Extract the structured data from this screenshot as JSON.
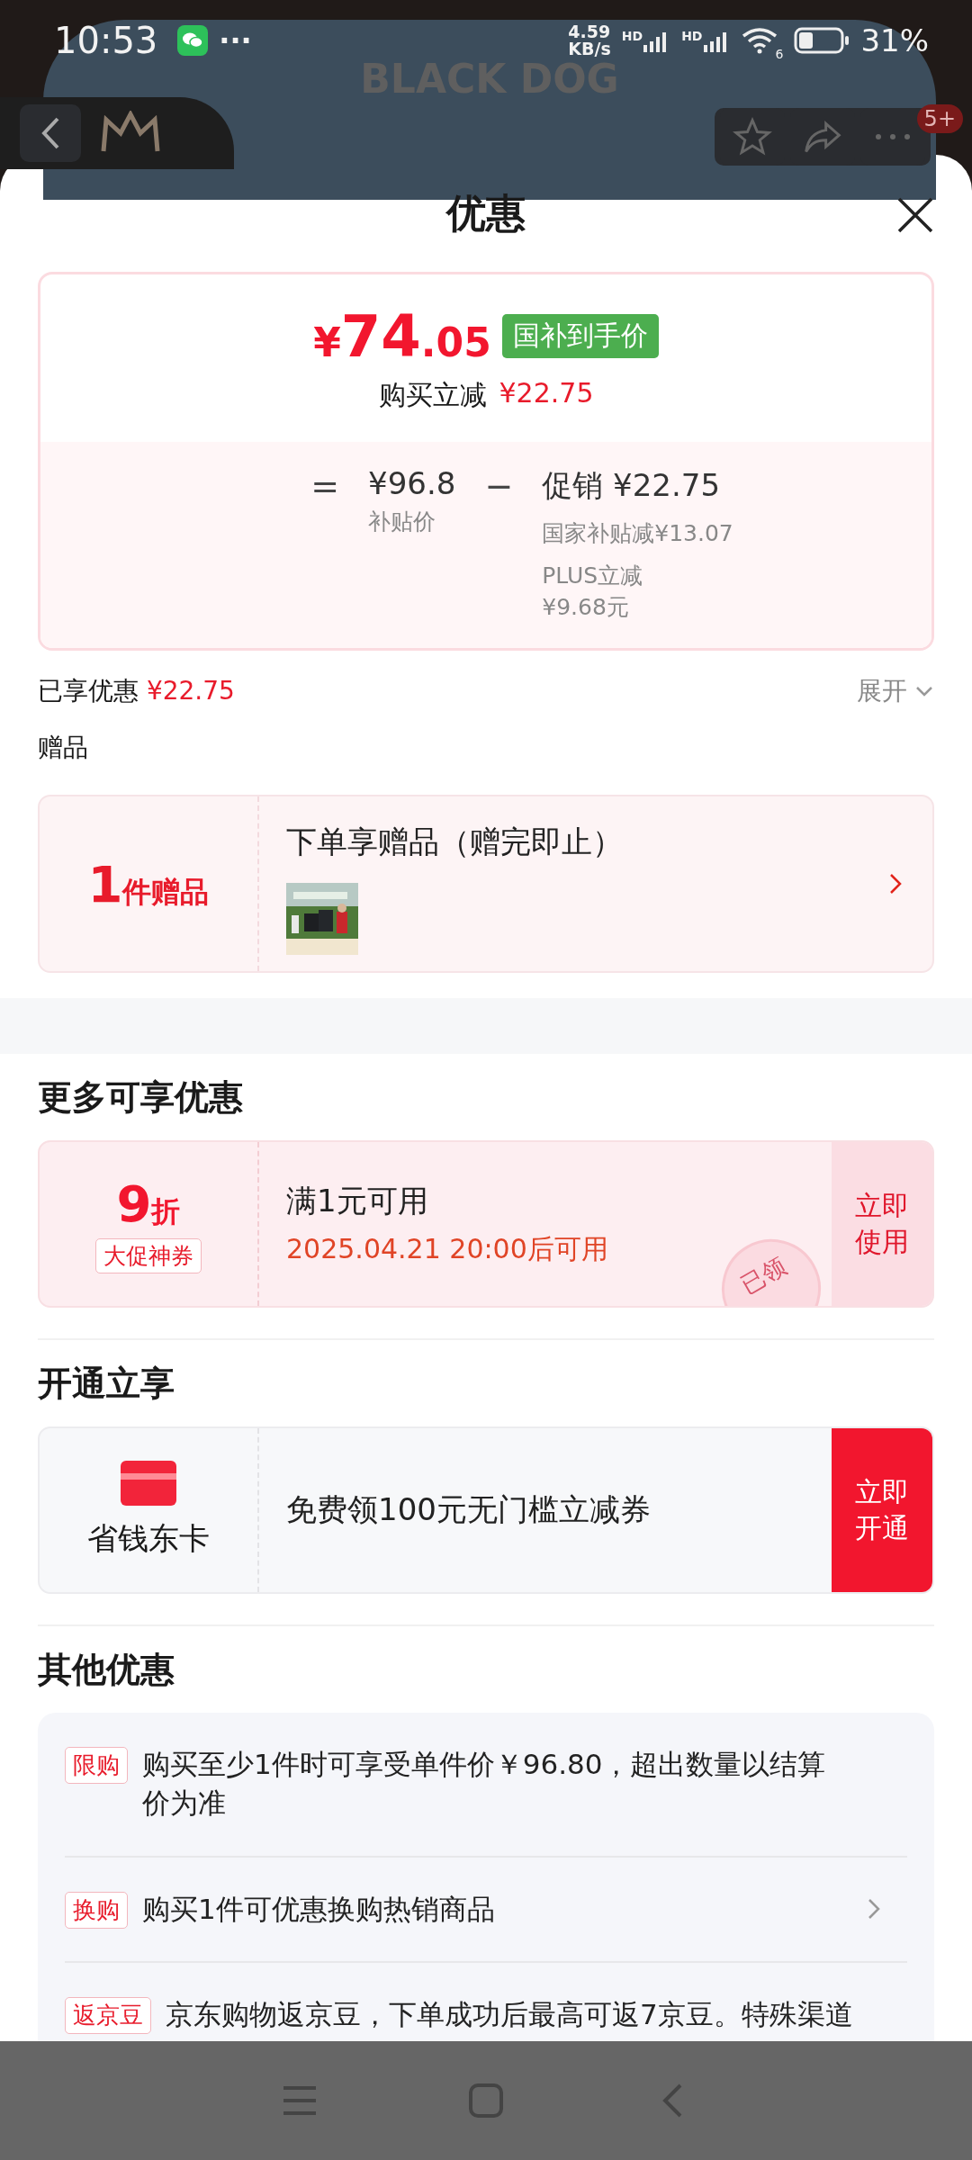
{
  "status_bar": {
    "time": "10:53",
    "more": "···",
    "speed_value": "4.59",
    "speed_unit": "KB/s",
    "signal_labels": [
      "HD",
      "HD"
    ],
    "wifi_label": "6",
    "battery": "31%"
  },
  "backdrop": {
    "logo": "BLACK DOG",
    "badge": "5+"
  },
  "sheet": {
    "title": "优惠"
  },
  "price_card": {
    "currency": "¥",
    "integer": "74",
    "decimal": ".05",
    "badge": "国补到手价",
    "saving_label": "购买立减",
    "saving_value": "¥22.75",
    "equals": "=",
    "base_price": "¥96.8",
    "base_label": "补贴价",
    "minus": "−",
    "promo_label": "促销",
    "promo_value": "¥22.75",
    "details": [
      [
        "国家补贴减¥13.07"
      ],
      [
        "PLUS立减",
        "¥9.68元"
      ]
    ]
  },
  "summary": {
    "label": "已享优惠",
    "value": "¥22.75",
    "toggle": "展开",
    "expanded": false
  },
  "gifts": {
    "heading": "赠品",
    "count": "1",
    "count_label": "件赠品",
    "title": "下单享赠品（赠完即止）"
  },
  "more_offers": {
    "heading": "更多可享优惠",
    "coupons": [
      {
        "discount": "9",
        "unit": "折",
        "tag": "大促神券",
        "condition": "满1元可用",
        "validity": "2025.04.21 20:00后可用",
        "action": "立即使用",
        "claimed": true,
        "stamp": "已领"
      }
    ]
  },
  "membership": {
    "heading": "开通立享",
    "card_name": "省钱东卡",
    "offer": "免费领100元无门槛立减券",
    "action": "立即开通"
  },
  "other_offers": {
    "heading": "其他优惠",
    "items": [
      {
        "tag": "限购",
        "text": "购买至少1件时可享受单件价￥96.80，超出数量以结算价为准",
        "has_arrow": false
      },
      {
        "tag": "换购",
        "text": "购买1件可优惠换购热销商品",
        "has_arrow": true
      },
      {
        "tag": "返京豆",
        "text": "京东购物返京豆，下单成功后最高可返7京豆。特殊渠道",
        "has_arrow": false
      }
    ]
  }
}
